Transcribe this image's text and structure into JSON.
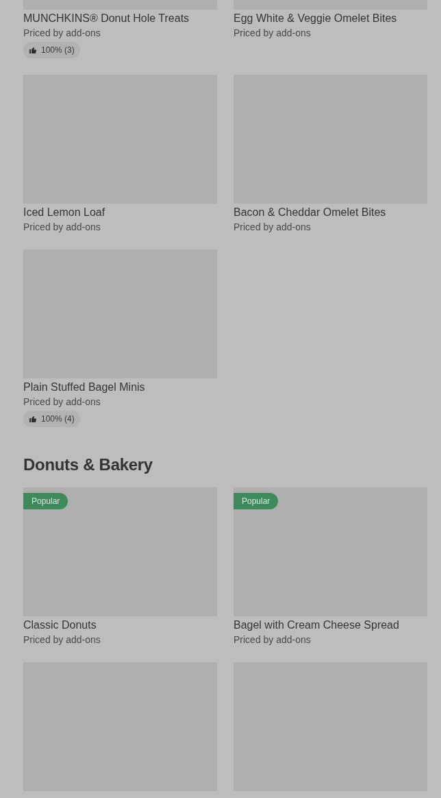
{
  "sections": [
    {
      "items": [
        {
          "kind": "dish",
          "name": "MUNCHKINS® Donut Hole Treats",
          "price": "Priced by add-ons",
          "rating": "100% (3)"
        },
        {
          "kind": "dish",
          "name": "Egg White & Veggie Omelet Bites",
          "price": "Priced by add-ons"
        },
        {
          "kind": "dish",
          "name": "Iced Lemon Loaf",
          "price": "Priced by add-ons"
        },
        {
          "kind": "dish",
          "name": "Bacon & Cheddar Omelet Bites",
          "price": "Priced by add-ons"
        },
        {
          "kind": "dish",
          "name": "Plain Stuffed Bagel Minis",
          "price": "Priced by add-ons",
          "rating": "100% (4)"
        }
      ]
    },
    {
      "title": "Donuts & Bakery",
      "items": [
        {
          "kind": "dish",
          "name": "Classic Donuts",
          "price": "Priced by add-ons",
          "badge": "Popular"
        },
        {
          "kind": "dish",
          "name": "Bagel with Cream Cheese Spread",
          "price": "Priced by add-ons",
          "badge": "Popular"
        },
        {
          "kind": "image-only"
        },
        {
          "kind": "image-only"
        }
      ]
    }
  ]
}
